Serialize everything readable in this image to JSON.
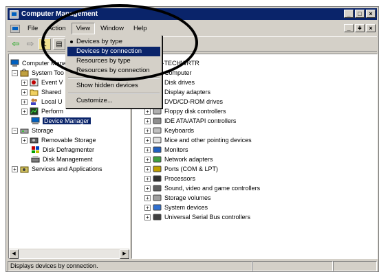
{
  "window": {
    "title": "Computer Management"
  },
  "menubar": {
    "items": [
      "File",
      "Action",
      "View",
      "Window",
      "Help"
    ]
  },
  "view_menu": {
    "items": [
      "Devices by type",
      "Devices by connection",
      "Resources by type",
      "Resources by connection",
      "Show hidden devices",
      "Customize..."
    ],
    "checked": "Devices by type",
    "highlighted": "Devices by connection"
  },
  "left_tree": {
    "root": "Computer Mana",
    "system_tools": "System Too",
    "event_viewer": "Event V",
    "shared_folders": "Shared",
    "local_users": "Local U",
    "performance": "Perform",
    "device_manager": "Device Manager",
    "storage": "Storage",
    "removable_storage": "Removable Storage",
    "disk_defragmenter": "Disk Defragmenter",
    "disk_management": "Disk Management",
    "services": "Services and Applications"
  },
  "right_tree": {
    "root": "GMA-TECHWRTR",
    "items": [
      "Computer",
      "Disk drives",
      "Display adapters",
      "DVD/CD-ROM drives",
      "Floppy disk controllers",
      "IDE ATA/ATAPI controllers",
      "Keyboards",
      "Mice and other pointing devices",
      "Monitors",
      "Network adapters",
      "Ports (COM & LPT)",
      "Processors",
      "Sound, video and game controllers",
      "Storage volumes",
      "System devices",
      "Universal Serial Bus controllers"
    ]
  },
  "statusbar": {
    "text": "Displays devices by connection."
  },
  "colors": {
    "titlebar": "#0a246a",
    "highlight": "#0a246a",
    "face": "#d4d0c8"
  }
}
